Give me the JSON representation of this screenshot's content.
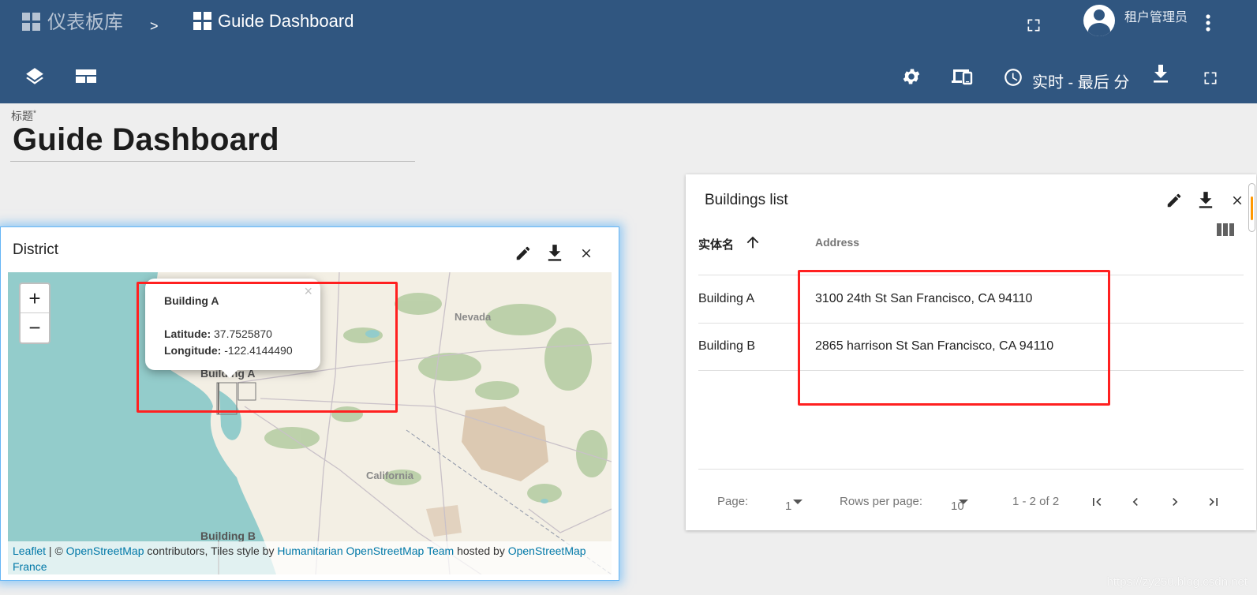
{
  "topbar": {
    "breadcrumb_root": "仪表板库",
    "breadcrumb_sep": ">",
    "breadcrumb_current": "Guide Dashboard",
    "user_name": "租户管理员",
    "time_window": "实时 - 最后 分"
  },
  "title": {
    "caption": "标题",
    "required_mark": "*",
    "value": "Guide Dashboard"
  },
  "district": {
    "title": "District",
    "zoom_in": "+",
    "zoom_out": "−",
    "popup": {
      "name": "Building A",
      "lat_label": "Latitude:",
      "lat_value": "37.7525870",
      "lon_label": "Longitude:",
      "lon_value": "-122.4144490",
      "close": "×"
    },
    "marker_label_a": "Building A",
    "marker_label_b": "Building B",
    "place_nevada": "Nevada",
    "place_california": "California",
    "attribution": {
      "leaflet": "Leaflet",
      "sep": " | © ",
      "osm": "OpenStreetMap",
      "contrib": " contributors, Tiles style by ",
      "hot": "Humanitarian OpenStreetMap Team",
      "hosted": " hosted by ",
      "osm_fr1": "OpenStreetMap",
      "osm_fr2": "France"
    }
  },
  "buildings": {
    "title": "Buildings list",
    "col_entity": "实体名",
    "col_address": "Address",
    "rows": [
      {
        "name": "Building A",
        "address": "3100 24th St San Francisco, CA 94110"
      },
      {
        "name": "Building B",
        "address": "2865 harrison St San Francisco, CA 94110"
      }
    ],
    "pager": {
      "page_label": "Page:",
      "page_value": "1",
      "rows_label": "Rows per page:",
      "rows_value": "10",
      "range": "1 - 2 of 2"
    }
  },
  "watermark": "https://zy250.blog.csdn.net",
  "colors": {
    "header_bg": "#305680",
    "highlight": "#ff2020",
    "focus_glow": "#64b5f6"
  }
}
